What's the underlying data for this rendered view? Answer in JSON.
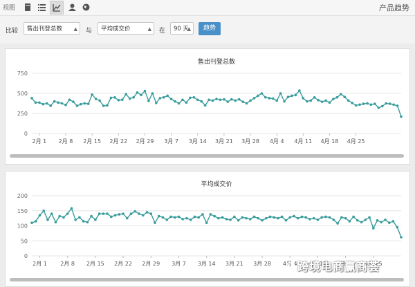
{
  "topbar": {
    "view_label": "视图",
    "icons": [
      "list-view-icon",
      "detail-list-icon",
      "trend-chart-icon",
      "user-icon",
      "globe-icon"
    ],
    "title": "产品趋势"
  },
  "controls": {
    "compare_label": "比较",
    "metric1": "售出刊登总数",
    "and_label": "与",
    "metric2": "平均成交价",
    "in_label": "在",
    "period": "90 天",
    "button_label": "趋势"
  },
  "colors": {
    "line": "#3a9c9c",
    "button": "#4a90c8"
  },
  "watermark": "跨境电商赢商荟",
  "chart_data": [
    {
      "type": "line",
      "title": "售出刊登总数",
      "ylim": [
        0,
        750
      ],
      "yticks": [
        "750",
        "500",
        "250",
        "0"
      ],
      "xticks": [
        "2月 1",
        "2月 8",
        "2月 15",
        "2月 22",
        "2月 29",
        "3月 7",
        "3月 14",
        "3月 21",
        "3月 28",
        "4月 4",
        "4月 11",
        "4月 18",
        "4月 25"
      ],
      "values": [
        440,
        385,
        385,
        365,
        375,
        345,
        400,
        385,
        375,
        355,
        420,
        395,
        345,
        365,
        375,
        370,
        485,
        430,
        410,
        345,
        350,
        445,
        450,
        415,
        420,
        490,
        435,
        450,
        510,
        480,
        530,
        405,
        500,
        380,
        440,
        450,
        470,
        430,
        400,
        375,
        420,
        385,
        445,
        450,
        420,
        400,
        350,
        420,
        410,
        430,
        420,
        425,
        395,
        425,
        410,
        425,
        395,
        375,
        410,
        440,
        470,
        500,
        450,
        440,
        435,
        410,
        500,
        400,
        455,
        470,
        480,
        535,
        440,
        400,
        410,
        450,
        415,
        395,
        410,
        385,
        430,
        450,
        490,
        455,
        410,
        380,
        350,
        360,
        370,
        375,
        360,
        370,
        320,
        340,
        375,
        370,
        360,
        345,
        210
      ]
    },
    {
      "type": "line",
      "title": "平均成交价",
      "ylim": [
        0,
        200
      ],
      "yticks": [
        "200",
        "150",
        "100",
        "50",
        "0"
      ],
      "xticks": [
        "2月 1",
        "2月 8",
        "2月 15",
        "2月 22",
        "2月 29",
        "3月 7",
        "3月 14",
        "3月 21",
        "3月 28",
        "4月 4",
        "4月 11",
        "4月 18",
        "4月 25"
      ],
      "values": [
        110,
        115,
        135,
        150,
        120,
        140,
        112,
        132,
        128,
        140,
        158,
        120,
        128,
        115,
        112,
        132,
        120,
        140,
        140,
        140,
        130,
        135,
        138,
        140,
        125,
        140,
        148,
        140,
        135,
        145,
        140,
        110,
        132,
        128,
        120,
        130,
        128,
        130,
        122,
        125,
        120,
        130,
        128,
        138,
        110,
        138,
        132,
        125,
        128,
        122,
        120,
        130,
        118,
        128,
        125,
        122,
        130,
        125,
        118,
        125,
        130,
        128,
        125,
        130,
        118,
        128,
        132,
        125,
        130,
        128,
        122,
        125,
        120,
        128,
        130,
        128,
        120,
        108,
        128,
        125,
        115,
        130,
        118,
        112,
        120,
        128,
        92,
        118,
        112,
        120,
        110,
        115,
        95,
        62
      ]
    }
  ]
}
